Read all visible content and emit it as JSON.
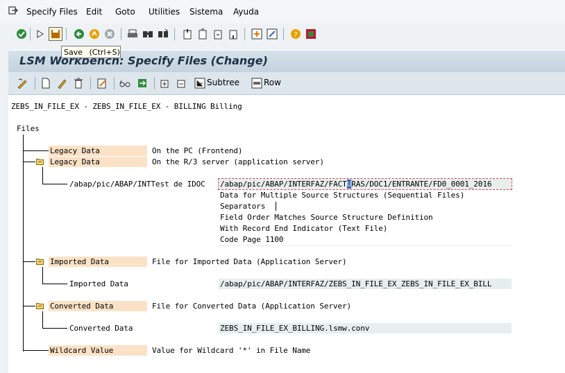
{
  "menu": {
    "items": [
      "Specify Files",
      "Edit",
      "Goto",
      "Utilities",
      "Sistema",
      "Ayuda"
    ]
  },
  "tooltip": {
    "text": "Save",
    "shortcut": "(Ctrl+S)"
  },
  "title": "LSM Workbench: Specify Files (Change)",
  "app_toolbar": {
    "subtree_label": "Subtree",
    "row_label": "Row"
  },
  "header_line": "ZEBS_IN_FILE_EX - ZEBS_IN_FILE_EX - BILLING Billing",
  "tree": {
    "root": "Files",
    "legacy_pc": {
      "label": "Legacy Data",
      "desc": "On the PC (Frontend)"
    },
    "legacy_server": {
      "label": "Legacy Data",
      "desc": "On the R/3 server (application server)"
    },
    "legacy_file": {
      "name": "/abap/pic/ABAP/INTTest de IDOC",
      "path_pre": "/abap/pic/ABAP/INTERFAZ/FACT",
      "path_sel": "U",
      "path_post": "RAS/DOC1/ENTRANTE/FD0_0001_2016",
      "props": [
        "Data for Multiple Source Structures (Sequential Files)",
        "Separators",
        "Field Order Matches Source Structure Definition",
        "With Record End Indicator (Text File)",
        "Code Page 1100"
      ]
    },
    "imported": {
      "label": "Imported Data",
      "desc": "File for Imported Data (Application Server)"
    },
    "imported_file": {
      "name": "Imported Data",
      "path": "/abap/pic/ABAP/INTERFAZ/ZEBS_IN_FILE_EX_ZEBS_IN_FILE_EX_BILL"
    },
    "converted": {
      "label": "Converted Data",
      "desc": "File for Converted Data (Application Server)"
    },
    "converted_file": {
      "name": "Converted Data",
      "path": "ZEBS_IN_FILE_EX_BILLING.lsmw.conv"
    },
    "wildcard": {
      "label": "Wildcard Value",
      "desc": "Value for Wildcard '*' in File Name"
    }
  },
  "colors": {
    "highlight": "#fbe2c6",
    "field": "#e6efee",
    "title": "#1d3145"
  }
}
